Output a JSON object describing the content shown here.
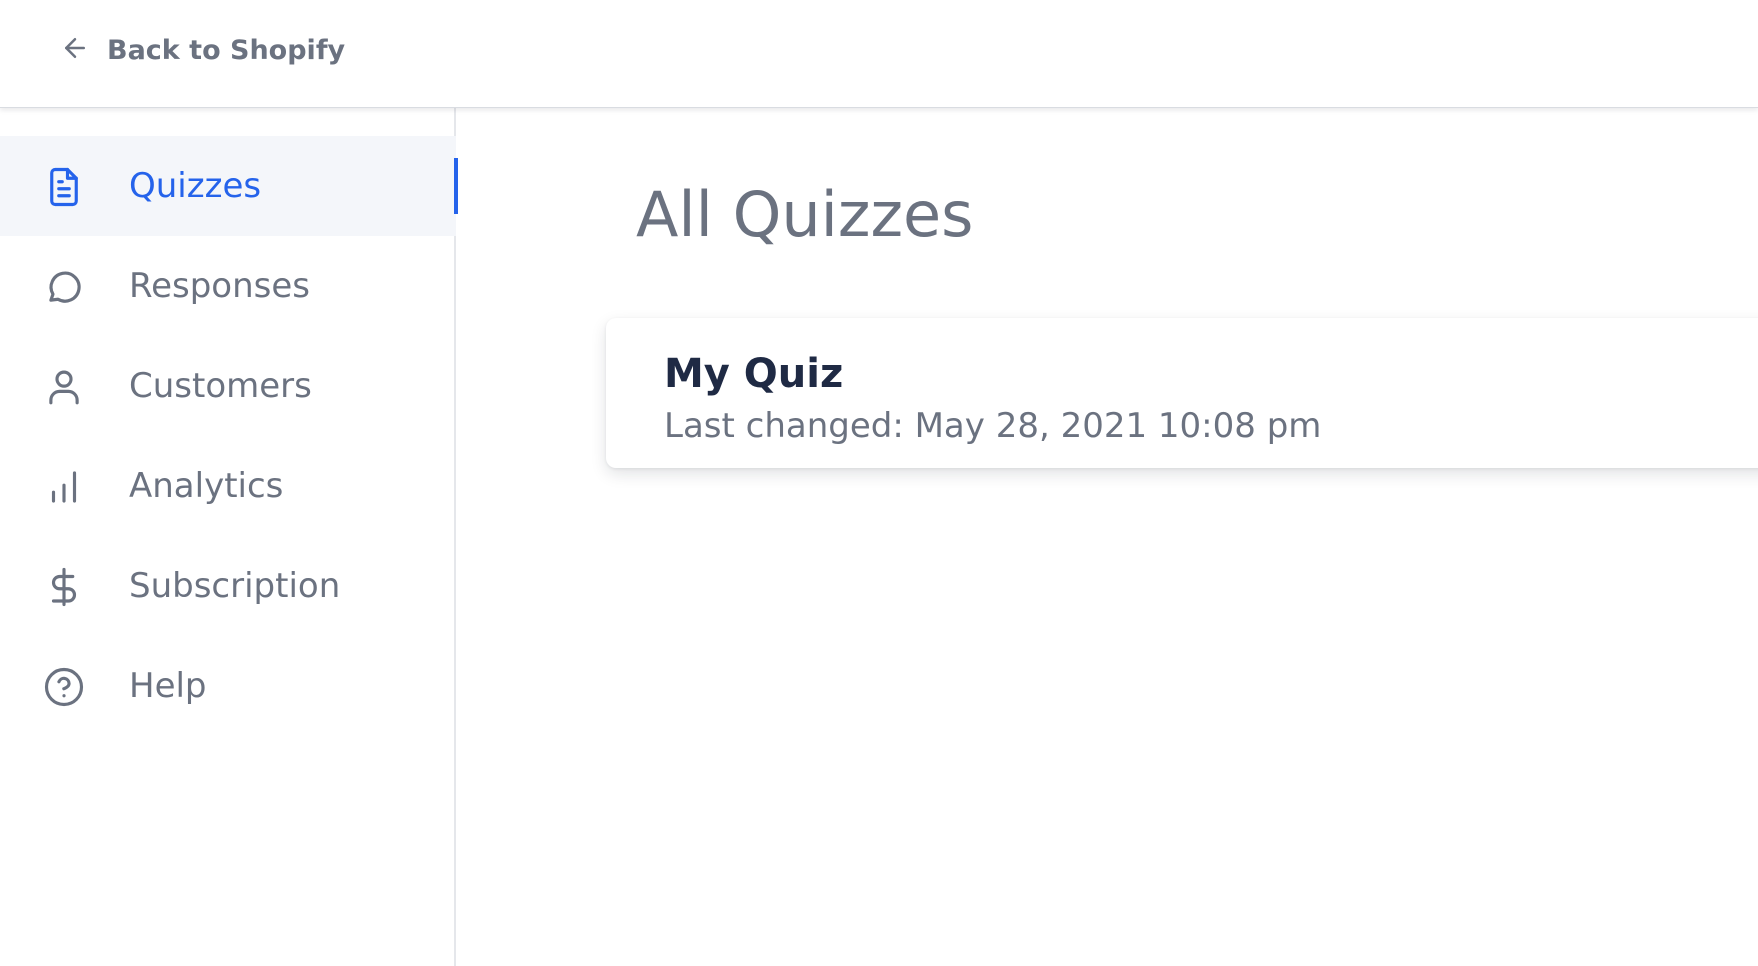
{
  "header": {
    "back_label": "Back to Shopify",
    "back_icon": "arrow-left-icon"
  },
  "sidebar": {
    "items": [
      {
        "label": "Quizzes",
        "icon": "document-icon",
        "active": true
      },
      {
        "label": "Responses",
        "icon": "chat-bubble-icon",
        "active": false
      },
      {
        "label": "Customers",
        "icon": "user-icon",
        "active": false
      },
      {
        "label": "Analytics",
        "icon": "bar-chart-icon",
        "active": false
      },
      {
        "label": "Subscription",
        "icon": "dollar-icon",
        "active": false
      },
      {
        "label": "Help",
        "icon": "question-circle-icon",
        "active": false
      }
    ]
  },
  "main": {
    "title": "All Quizzes",
    "quizzes": [
      {
        "name": "My Quiz",
        "last_changed": "Last changed: May 28, 2021 10:08 pm"
      }
    ]
  },
  "colors": {
    "accent": "#2563eb",
    "text_muted": "#6b7280",
    "text_dark": "#1f2a44",
    "active_bg": "#f4f6fa"
  }
}
